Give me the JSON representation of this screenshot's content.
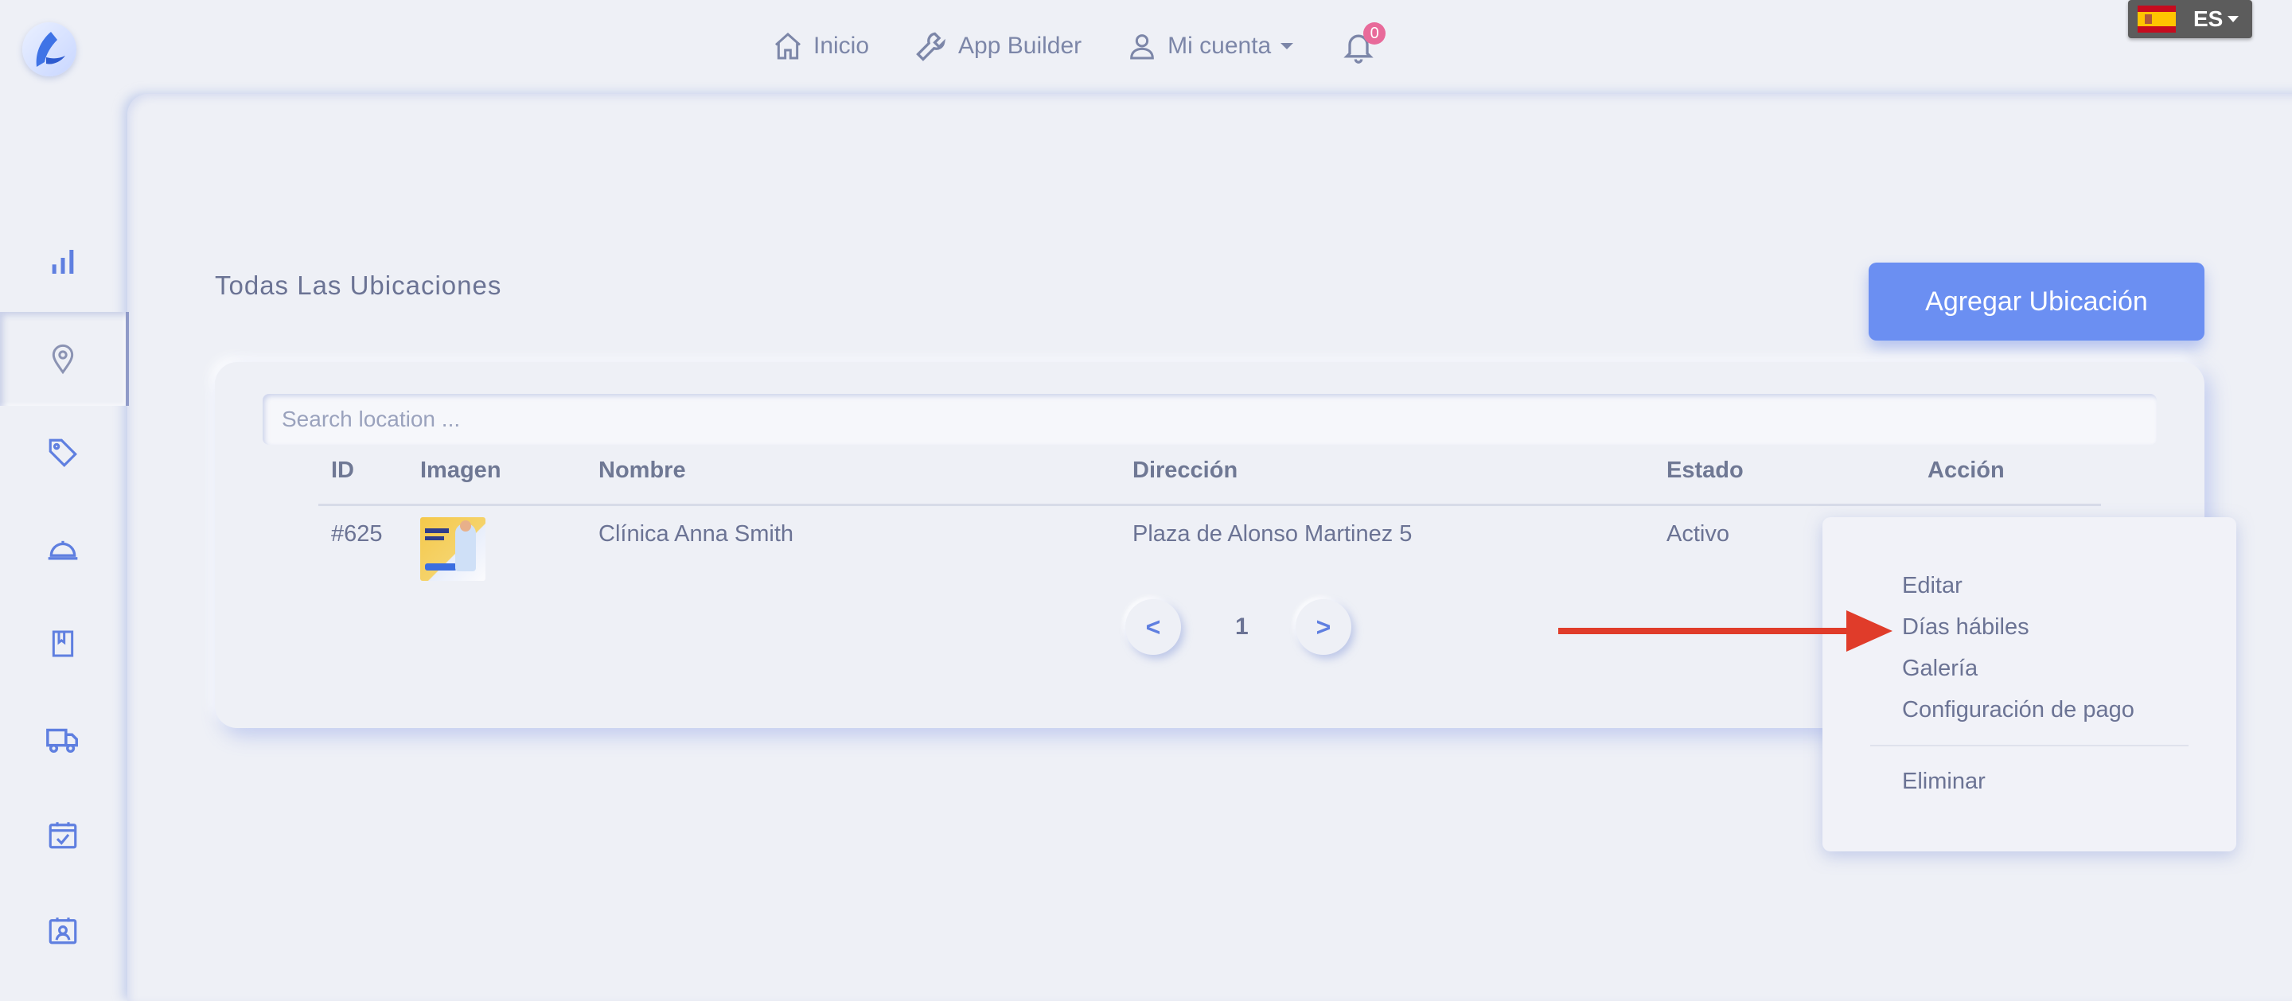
{
  "topbar": {
    "nav": [
      {
        "label": "Inicio",
        "icon": "home-icon"
      },
      {
        "label": "App Builder",
        "icon": "wrench-icon"
      },
      {
        "label": "Mi cuenta",
        "icon": "user-icon"
      }
    ],
    "notifications_count": "0",
    "language": {
      "code": "ES",
      "flag": "spain-flag-icon"
    }
  },
  "sidebar": {
    "items": [
      {
        "icon": "bar-chart-icon"
      },
      {
        "icon": "map-pin-icon",
        "active": true
      },
      {
        "icon": "tag-icon"
      },
      {
        "icon": "cloche-icon"
      },
      {
        "icon": "bookmark-book-icon"
      },
      {
        "icon": "truck-icon"
      },
      {
        "icon": "calendar-check-icon"
      },
      {
        "icon": "contact-calendar-icon"
      }
    ]
  },
  "page": {
    "title": "Todas Las Ubicaciones",
    "add_button": "Agregar Ubicación"
  },
  "search": {
    "placeholder": "Search location ..."
  },
  "table": {
    "headers": [
      "ID",
      "Imagen",
      "Nombre",
      "Dirección",
      "Estado",
      "Acción"
    ],
    "rows": [
      {
        "id": "#625",
        "name": "Clínica Anna Smith",
        "address": "Plaza de Alonso Martinez 5",
        "status": "Activo"
      }
    ]
  },
  "pagination": {
    "prev": "<",
    "page": "1",
    "next": ">"
  },
  "action_menu": {
    "items": [
      "Editar",
      "Días hábiles",
      "Galería",
      "Configuración de pago"
    ],
    "danger": "Eliminar"
  },
  "colors": {
    "accent": "#6b8ff2",
    "annotation_arrow": "#e03c2a",
    "badge": "#e86a9a"
  }
}
